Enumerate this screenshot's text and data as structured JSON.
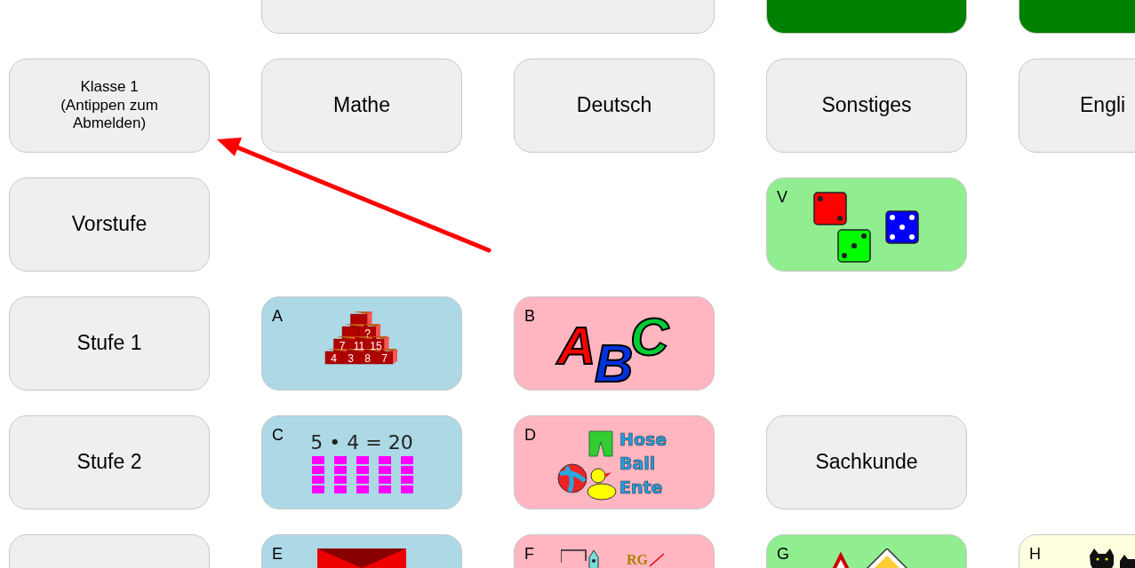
{
  "rows": [
    {
      "cells": [
        {
          "kind": "empty"
        },
        {
          "kind": "wide",
          "color": "#efefef"
        },
        {
          "kind": "button",
          "color": "#008000"
        },
        {
          "kind": "button",
          "color": "#008000"
        }
      ]
    },
    {
      "cells": [
        {
          "kind": "button",
          "small": true,
          "color": "#efefef",
          "label": "Klasse 1\n(Antippen zum\nAbmelden)"
        },
        {
          "kind": "button",
          "color": "#efefef",
          "label": "Mathe"
        },
        {
          "kind": "button",
          "color": "#efefef",
          "label": "Deutsch"
        },
        {
          "kind": "button",
          "color": "#efefef",
          "label": "Sonstiges"
        },
        {
          "kind": "button",
          "color": "#efefef",
          "label": "Engli"
        }
      ]
    },
    {
      "cells": [
        {
          "kind": "button",
          "color": "#efefef",
          "label": "Vorstufe"
        },
        {
          "kind": "empty"
        },
        {
          "kind": "empty"
        },
        {
          "kind": "dice",
          "color": "#90ee90",
          "letter": "V"
        }
      ]
    },
    {
      "cells": [
        {
          "kind": "button",
          "color": "#efefef",
          "label": "Stufe 1"
        },
        {
          "kind": "pyramid",
          "color": "#add8e6",
          "letter": "A",
          "numbers": [
            "?",
            "7",
            "11",
            "15",
            "4",
            "3",
            "8",
            "7"
          ]
        },
        {
          "kind": "abc",
          "color": "#ffb6c1",
          "letter": "B",
          "letters": [
            "A",
            "B",
            "C"
          ]
        }
      ]
    },
    {
      "cells": [
        {
          "kind": "button",
          "color": "#efefef",
          "label": "Stufe 2"
        },
        {
          "kind": "multiply",
          "color": "#add8e6",
          "letter": "C",
          "equation": "5 • 4 = 20"
        },
        {
          "kind": "words",
          "color": "#ffb6c1",
          "letter": "D",
          "words": [
            "Hose",
            "Ball",
            "Ente"
          ]
        },
        {
          "kind": "button",
          "color": "#efefef",
          "label": "Sachkunde"
        }
      ]
    },
    {
      "cells": [
        {
          "kind": "button",
          "color": "#efefef"
        },
        {
          "kind": "envelope",
          "color": "#add8e6",
          "letter": "E"
        },
        {
          "kind": "pencil",
          "color": "#ffb6c1",
          "letter": "F",
          "letters": "RG"
        },
        {
          "kind": "signs",
          "color": "#90ee90",
          "letter": "G"
        },
        {
          "kind": "cats",
          "color": "#ffffe0",
          "letter": "H"
        }
      ]
    }
  ]
}
